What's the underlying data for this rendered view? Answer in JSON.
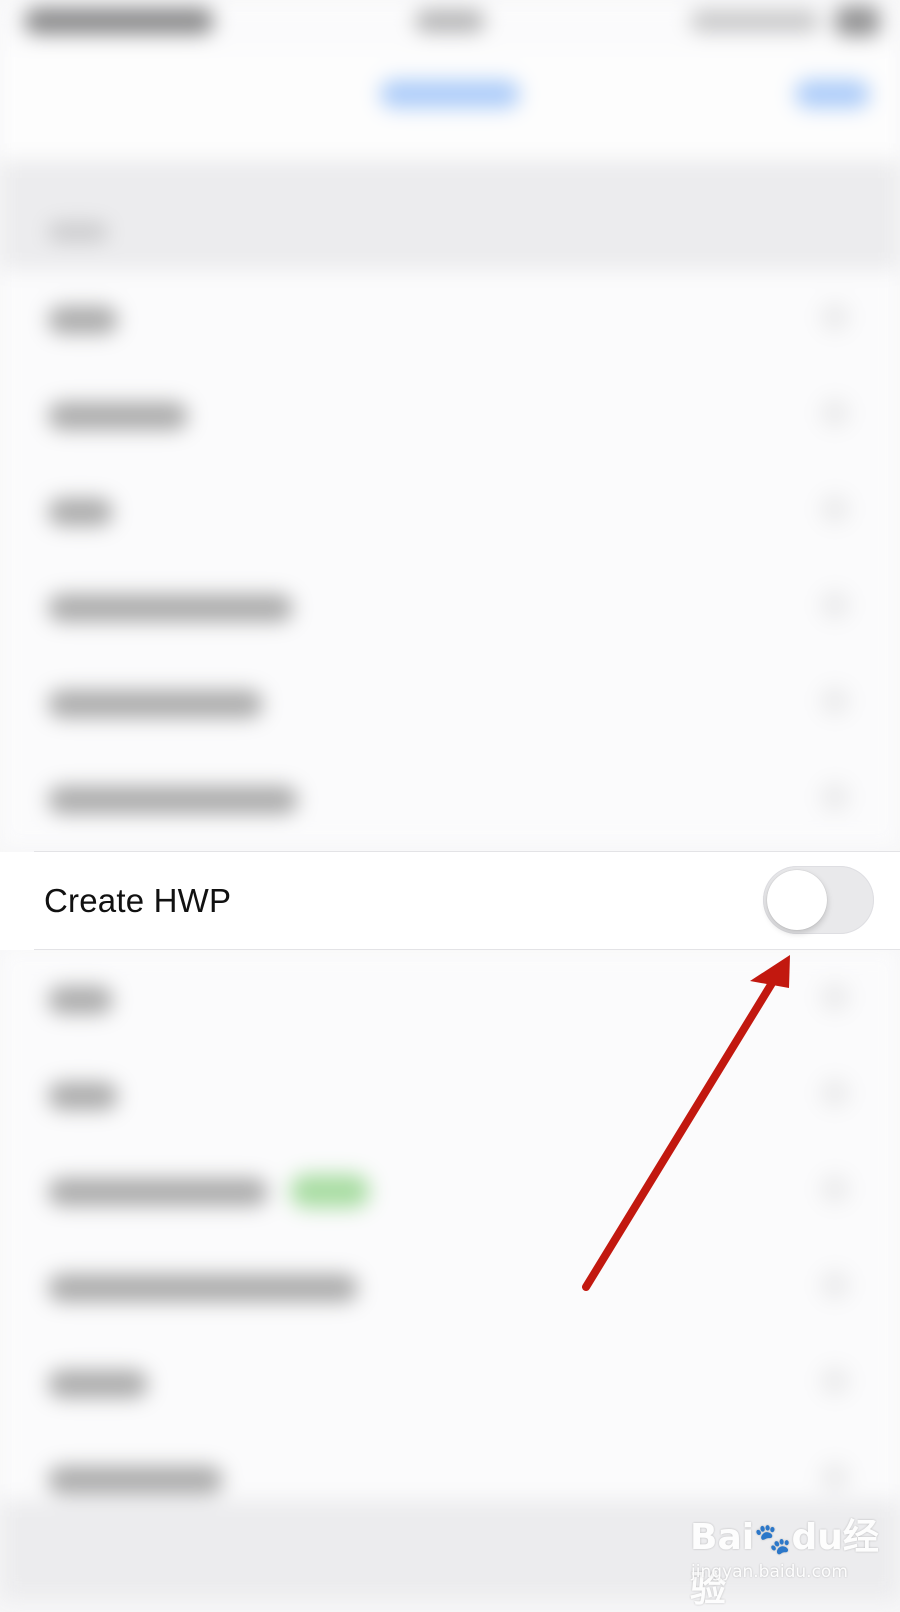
{
  "focused_row": {
    "label": "Create HWP",
    "toggle_on": false
  },
  "annotation": {
    "arrow_color": "#c2180f"
  },
  "watermark": {
    "logo_text": "Baidu经验",
    "url_text": "jingyan.baidu.com"
  },
  "colors": {
    "background": "#f7f7f8",
    "toggle_track_off": "#e9e9eb",
    "accent_blue": "#4a90f5"
  }
}
